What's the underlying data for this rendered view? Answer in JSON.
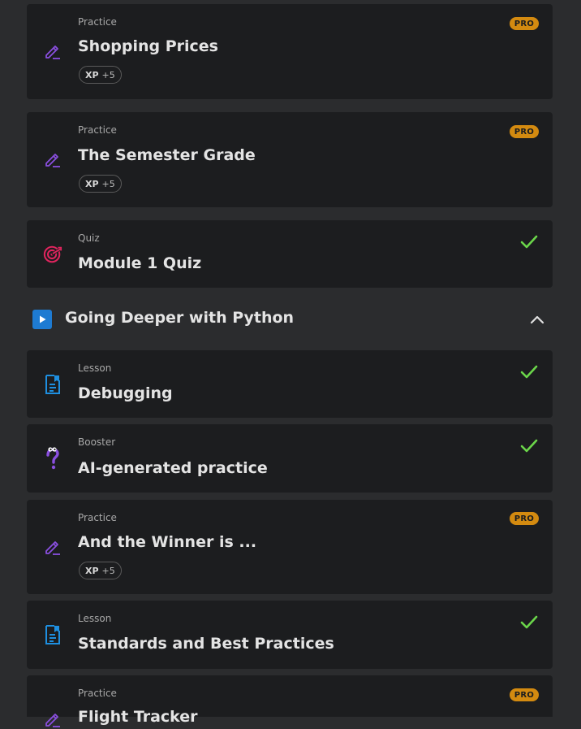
{
  "items_top": [
    {
      "category": "Practice",
      "title": "Shopping Prices",
      "badge": "PRO",
      "xp_label": "XP",
      "xp_value": "+5",
      "icon": "pencil-icon"
    },
    {
      "category": "Practice",
      "title": "The Semester Grade",
      "badge": "PRO",
      "xp_label": "XP",
      "xp_value": "+5",
      "icon": "pencil-icon"
    },
    {
      "category": "Quiz",
      "title": "Module 1 Quiz",
      "status": "completed",
      "icon": "target-icon"
    }
  ],
  "section": {
    "title": "Going Deeper with Python",
    "icon": "play-icon",
    "expanded": true
  },
  "items_section": [
    {
      "category": "Lesson",
      "title": "Debugging",
      "status": "completed",
      "icon": "lesson-doc-icon"
    },
    {
      "category": "Booster",
      "title": "AI-generated practice",
      "status": "completed",
      "icon": "question-mark-icon"
    },
    {
      "category": "Practice",
      "title": "And the Winner is ...",
      "badge": "PRO",
      "xp_label": "XP",
      "xp_value": "+5",
      "icon": "pencil-icon"
    },
    {
      "category": "Lesson",
      "title": "Standards and Best Practices",
      "status": "completed",
      "icon": "lesson-doc-icon"
    },
    {
      "category": "Practice",
      "title": "Flight Tracker",
      "badge": "PRO",
      "icon": "pencil-icon"
    }
  ],
  "colors": {
    "pro": "#d38a10",
    "check": "#6bd64a",
    "practice_icon": "#8a4fe0",
    "quiz_icon": "#e0245e",
    "lesson_icon": "#1e8fe0",
    "section_icon": "#1e7bd2"
  }
}
